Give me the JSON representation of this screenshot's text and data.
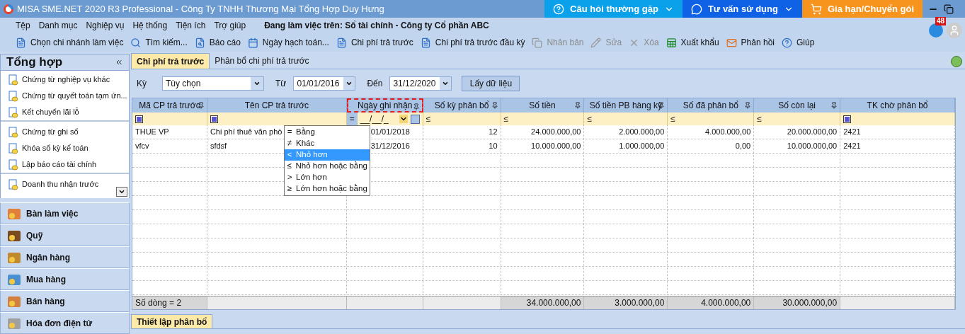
{
  "window": {
    "title": "MISA SME.NET 2020 R3 Professional - Công Ty TNHH Thương Mại Tổng Hợp Duy Hưng"
  },
  "header_buttons": [
    {
      "label": "Câu hỏi thường gặp",
      "color": "#0aa0ea"
    },
    {
      "label": "Tư vấn sử dụng",
      "color": "#0f62e6"
    },
    {
      "label": "Gia hạn/Chuyển gói",
      "color": "#f7941d"
    }
  ],
  "notification_count": "48",
  "menu": [
    "Tệp",
    "Danh mục",
    "Nghiệp vụ",
    "Hệ thống",
    "Tiện ích",
    "Trợ giúp"
  ],
  "workspace": "Đang làm việc trên: Sổ tài chính - Công ty Cổ phần ABC",
  "toolbar": [
    {
      "label": "Chọn chi nhánh làm việc",
      "disabled": false
    },
    {
      "label": "Tìm kiếm...",
      "disabled": false
    },
    {
      "label": "Báo cáo",
      "disabled": false
    },
    {
      "label": "Ngày hạch toán...",
      "disabled": false
    },
    {
      "label": "Chi phí trả trước",
      "disabled": false
    },
    {
      "label": "Chi phí trả trước đầu kỳ",
      "disabled": false
    },
    {
      "label": "Nhân bản",
      "disabled": true
    },
    {
      "label": "Sửa",
      "disabled": true
    },
    {
      "label": "Xóa",
      "disabled": true
    },
    {
      "label": "Xuất khẩu",
      "disabled": false
    },
    {
      "label": "Phản hồi",
      "disabled": false
    },
    {
      "label": "Giúp",
      "disabled": false
    }
  ],
  "sidebar": {
    "title": "Tổng hợp",
    "groups": [
      [
        "Chứng từ nghiệp vụ khác",
        "Chứng từ quyết toán tạm ứn...",
        "Kết chuyển lãi lỗ"
      ],
      [
        "Chứng từ ghi sổ",
        "Khóa sổ kỳ kế toán",
        "Lập báo cáo tài chính"
      ],
      [
        "Doanh thu nhận trước"
      ]
    ],
    "modules": [
      "Bàn làm việc",
      "Quỹ",
      "Ngân hàng",
      "Mua hàng",
      "Bán hàng",
      "Hóa đơn điện tử"
    ]
  },
  "tabs": [
    {
      "label": "Chi phí trả trước",
      "selected": true
    },
    {
      "label": "Phân bổ chi phí trả trước",
      "selected": false
    }
  ],
  "filter": {
    "period_label": "Kỳ",
    "period": "Tùy chọn",
    "from_label": "Từ",
    "from": "01/01/2016",
    "to_label": "Đến",
    "to": "31/12/2020",
    "button": "Lấy dữ liệu"
  },
  "table": {
    "columns": [
      {
        "label": "Mã CP trả trước",
        "pinned": true,
        "highlighted": false,
        "kind": "text",
        "filter": {
          "kind": "checkbox",
          "checked": true
        }
      },
      {
        "label": "Tên CP trả trước",
        "pinned": false,
        "highlighted": false,
        "kind": "text",
        "filter": {
          "kind": "checkbox",
          "checked": true
        }
      },
      {
        "label": "Ngày ghi nhận",
        "pinned": true,
        "highlighted": true,
        "kind": "date",
        "filter": {
          "kind": "date",
          "operator": "=",
          "mask": "__/__/_"
        }
      },
      {
        "label": "Số kỳ phân bổ",
        "pinned": true,
        "highlighted": false,
        "kind": "number",
        "filter": {
          "kind": "operator",
          "operator": "≤"
        }
      },
      {
        "label": "Số tiền",
        "pinned": true,
        "highlighted": false,
        "kind": "number",
        "filter": {
          "kind": "operator",
          "operator": "≤"
        },
        "total": "34.000.000,00"
      },
      {
        "label": "Số tiền PB hàng kỳ",
        "pinned": true,
        "highlighted": false,
        "kind": "number",
        "filter": {
          "kind": "operator",
          "operator": "≤"
        },
        "total": "3.000.000,00"
      },
      {
        "label": "Số đã phân bổ",
        "pinned": true,
        "highlighted": false,
        "kind": "number",
        "filter": {
          "kind": "operator",
          "operator": "≤"
        },
        "total": "4.000.000,00"
      },
      {
        "label": "Số còn lại",
        "pinned": true,
        "highlighted": false,
        "kind": "number",
        "filter": {
          "kind": "operator",
          "operator": "≤"
        },
        "total": "30.000.000,00"
      },
      {
        "label": "TK chờ phân bổ",
        "pinned": false,
        "highlighted": false,
        "kind": "text",
        "filter": {
          "kind": "checkbox",
          "checked": true
        }
      }
    ],
    "rows": [
      [
        "THUE VP",
        "Chi phí thuê văn phò",
        "01/01/2018",
        "12",
        "24.000.000,00",
        "2.000.000,00",
        "4.000.000,00",
        "20.000.000,00",
        "2421"
      ],
      [
        "vfcv",
        "sfdsf",
        "31/12/2016",
        "10",
        "10.000.000,00",
        "1.000.000,00",
        "0,00",
        "10.000.000,00",
        "2421"
      ]
    ],
    "footer": {
      "row_count": "Số dòng = 2"
    }
  },
  "operator_menu": [
    {
      "symbol": "=",
      "label": "Bằng",
      "selected": false
    },
    {
      "symbol": "≠",
      "label": "Khác",
      "selected": false
    },
    {
      "symbol": "<",
      "label": "Nhỏ hơn",
      "selected": true
    },
    {
      "symbol": "≤",
      "label": "Nhỏ hơn hoặc bằng",
      "selected": false
    },
    {
      "symbol": ">",
      "label": "Lớn hơn",
      "selected": false
    },
    {
      "symbol": "≥",
      "label": "Lớn hơn hoặc bằng",
      "selected": false
    }
  ],
  "bottom_tab": {
    "label": "Thiết lập phân bổ",
    "selected": true
  }
}
